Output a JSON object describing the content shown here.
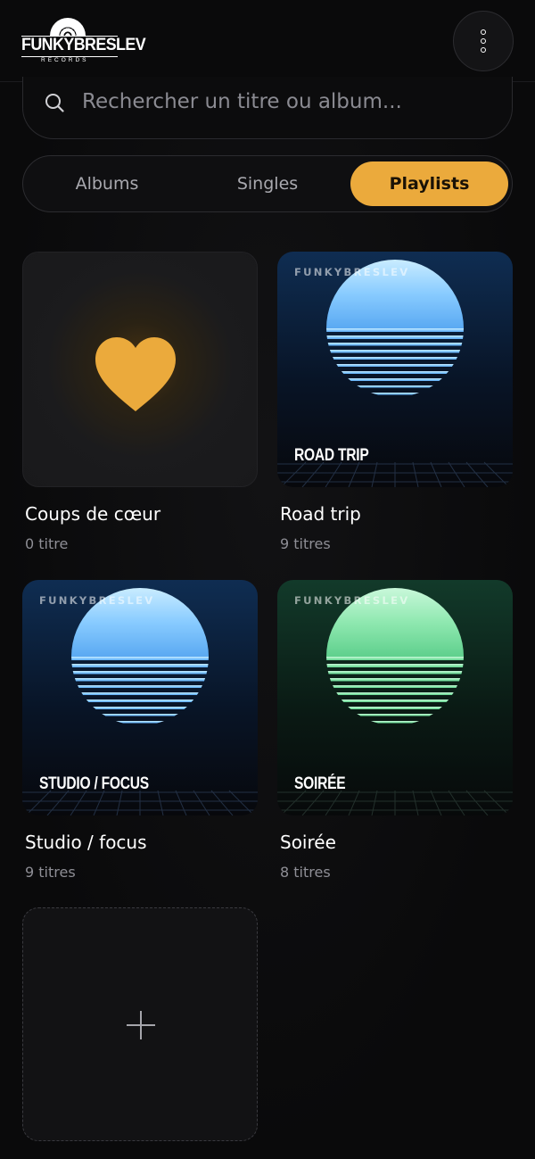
{
  "app": {
    "brand": "FUNKYBRESLEV",
    "brand_sub": "RECORDS"
  },
  "search": {
    "placeholder": "Rechercher un titre ou album..."
  },
  "tabs": [
    {
      "label": "Albums",
      "active": false
    },
    {
      "label": "Singles",
      "active": false
    },
    {
      "label": "Playlists",
      "active": true
    }
  ],
  "playlists": [
    {
      "title": "Coups de cœur",
      "count": "0 titre",
      "icon": "heart-icon",
      "accent": "#ebaa3c"
    },
    {
      "title": "Road trip",
      "count": "9 titres",
      "cover_label": "ROAD TRIP",
      "cover_brand": "FUNKYBRESLEV",
      "theme": "blue"
    },
    {
      "title": "Studio / focus",
      "count": "9 titres",
      "cover_label": "STUDIO / FOCUS",
      "cover_brand": "FUNKYBRESLEV",
      "theme": "blue"
    },
    {
      "title": "Soirée",
      "count": "8 titres",
      "cover_label": "SOIRÉE",
      "cover_brand": "FUNKYBRESLEV",
      "theme": "green"
    }
  ],
  "add_playlist": {
    "icon": "plus-icon"
  },
  "colors": {
    "accent": "#ebaa3c",
    "background": "#0b0b0c",
    "blue_sun": "#7cc6ff",
    "green_sun": "#7fe3a3"
  }
}
